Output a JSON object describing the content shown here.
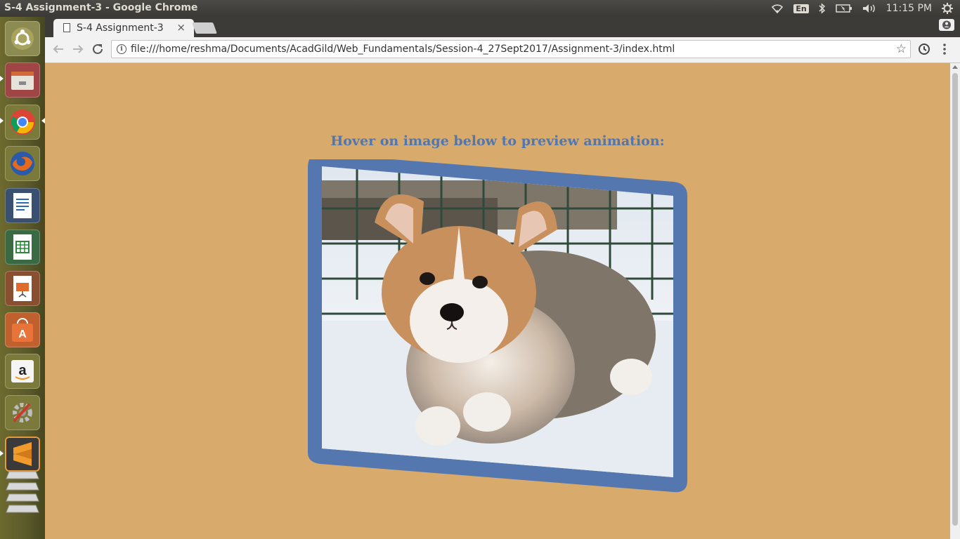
{
  "window": {
    "title": "S-4 Assignment-3 - Google Chrome"
  },
  "tray": {
    "language": "En",
    "time": "11:15 PM"
  },
  "launcher": {
    "items": [
      {
        "name": "ubuntu-dash-icon",
        "color": "#8a8a4f"
      },
      {
        "name": "files-icon",
        "color": "#9b3a3a"
      },
      {
        "name": "chrome-icon",
        "color": "#6c6a30"
      },
      {
        "name": "firefox-icon",
        "color": "#6c6a30"
      },
      {
        "name": "writer-icon",
        "color": "#2f4f6f"
      },
      {
        "name": "calc-icon",
        "color": "#2f6f3f"
      },
      {
        "name": "impress-icon",
        "color": "#8a4a2a"
      },
      {
        "name": "software-center-icon",
        "color": "#b45a2a"
      },
      {
        "name": "amazon-icon",
        "color": "#6c6a30"
      },
      {
        "name": "system-settings-icon",
        "color": "#6c6a30"
      },
      {
        "name": "sublime-text-icon",
        "color": "#3a3a3a"
      },
      {
        "name": "workspaces-icon",
        "color": "#6c6a30"
      }
    ]
  },
  "browser": {
    "tab_title": "S-4 Assignment-3",
    "tab_close": "×",
    "url": "file:///home/reshma/Documents/AcadGild/Web_Fundamentals/Session-4_27Sept2017/Assignment-3/index.html"
  },
  "page": {
    "heading": "Hover on image below to preview animation:",
    "frame_color": "#5577b0",
    "background_color": "#d8aa6b"
  }
}
